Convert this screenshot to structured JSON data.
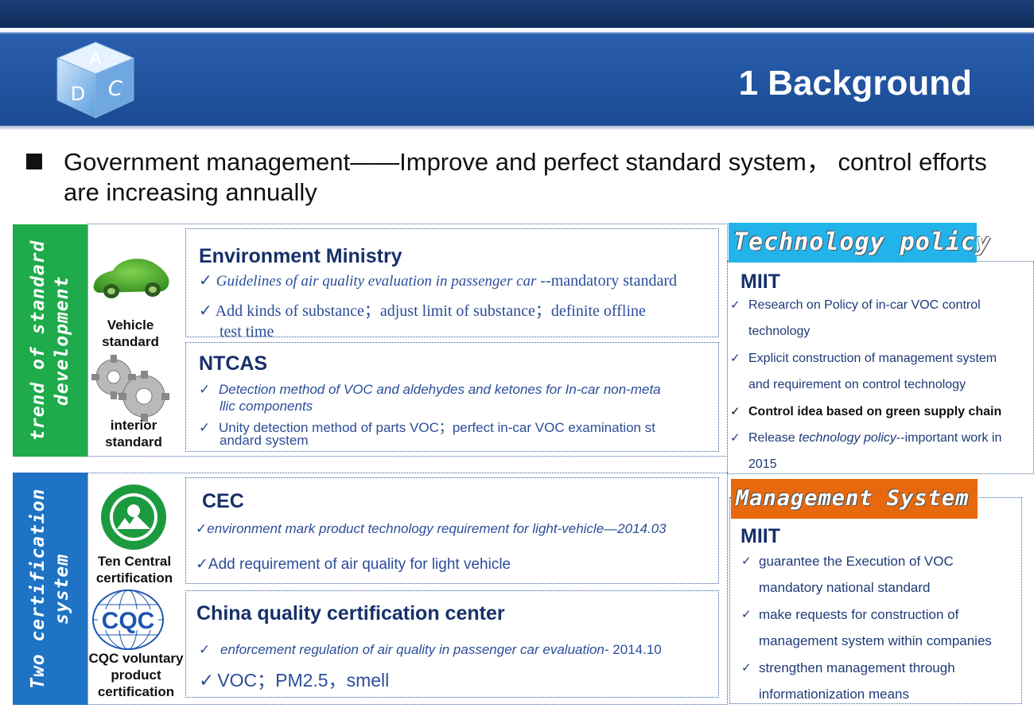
{
  "logo": {
    "letters": [
      "A",
      "D",
      "C"
    ]
  },
  "header": {
    "title": "1 Background"
  },
  "intro": {
    "text": "Government management——Improve and perfect standard system， control efforts are increasing annually"
  },
  "left_sections": {
    "trend": {
      "vertical_label": "trend of standard development",
      "color": "#1faa4b",
      "vehicle_label": "Vehicle standard",
      "interior_label": "interior standard"
    },
    "cert": {
      "vertical_label": "Two certification system",
      "color": "#1e73c4",
      "ten_central_label": "Ten Central certification",
      "cqc_logo_text": "CQC",
      "cqc_label": "CQC voluntary product certification"
    }
  },
  "boxes": {
    "env": {
      "title": "Environment Ministry",
      "line1_italic": "Guidelines of  air quality evaluation in passenger car",
      "line1_rest": " --mandatory standard",
      "line2": "Add kinds of substance；adjust limit of substance；definite offline",
      "line3": "test time"
    },
    "ntcas": {
      "title": "NTCAS",
      "item1a": "Detection method of VOC and aldehydes and ketones for In-car non-meta",
      "item1b": "llic components",
      "item2a": "Unity detection method of parts VOC；perfect in-car VOC examination st",
      "item2b": "andard system"
    },
    "cec": {
      "title": "CEC",
      "item1": "environment mark product technology requirement for light-vehicle—2014.03",
      "item2": "Add requirement of air quality for light vehicle"
    },
    "cqcc": {
      "title": "China quality certification center",
      "item1_italic": "enforcement regulation of air quality in passenger car evaluation",
      "item1_rest": "- 2014.10",
      "item2": "VOC；PM2.5，smell"
    }
  },
  "check_mark": "✓",
  "tech": {
    "tag": "Technology policy",
    "tag_color": "#21b3ea",
    "org": "MIIT",
    "lines": [
      "Research on Policy of  in-car VOC control",
      "technology",
      "Explicit construction of management system",
      "and requirement on control technology",
      "Control idea based on green supply chain",
      "Release ",
      "2015"
    ],
    "release_italic": "technology policy",
    "release_rest": "--important work in"
  },
  "mgmt": {
    "tag": "Management System",
    "tag_color": "#e8690d",
    "org": "MIIT",
    "lines": [
      "guarantee the Execution of VOC",
      "mandatory national standard",
      "make requests for construction of",
      "management system within companies",
      " strengthen management through",
      "informationization means"
    ]
  }
}
